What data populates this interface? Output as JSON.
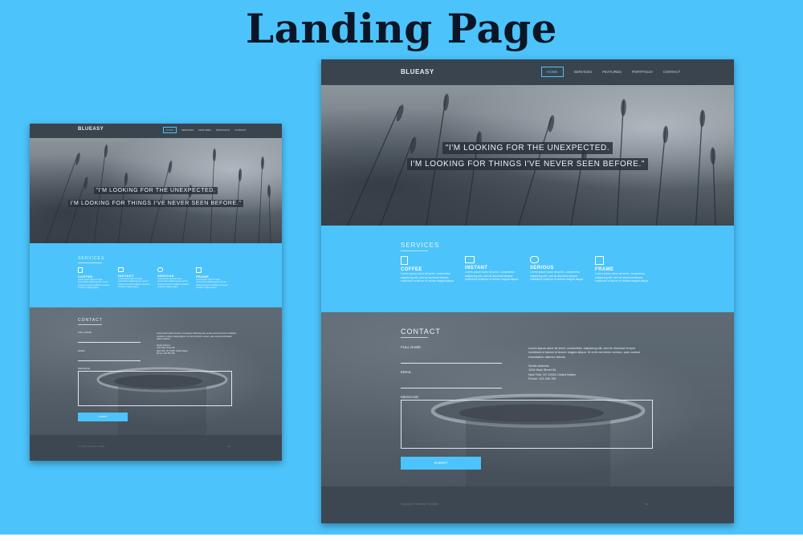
{
  "title": "Landing Page",
  "brand": "BLUEASY",
  "nav": [
    "HOME",
    "SERVICES",
    "FEATURES",
    "PORTFOLIO",
    "CONTACT"
  ],
  "quote": {
    "line1": "\"I'M LOOKING FOR THE UNEXPECTED.",
    "line2": "I'M LOOKING FOR THINGS I'VE NEVER SEEN BEFORE.\""
  },
  "services": {
    "title": "SERVICES",
    "items": [
      {
        "name": "COFFEE",
        "icon": "coffee-cup-icon",
        "desc": "Lorem ipsum dolor sit amet, consectetur adipiscing elit, sed do eiusmod tempor incididunt ut labore et dolore magna aliqua."
      },
      {
        "name": "INSTANT",
        "icon": "monitor-icon",
        "desc": "Lorem ipsum dolor sit amet, consectetur adipiscing elit, sed do eiusmod tempor incididunt ut labore et dolore magna aliqua."
      },
      {
        "name": "SERIOUS",
        "icon": "people-icon",
        "desc": "Lorem ipsum dolor sit amet, consectetur adipiscing elit, sed do eiusmod tempor incididunt ut labore et dolore magna aliqua."
      },
      {
        "name": "FRAME",
        "icon": "frame-icon",
        "desc": "Lorem ipsum dolor sit amet, consectetur adipiscing elit, sed do eiusmod tempor incididunt ut labore et dolore magna aliqua."
      }
    ]
  },
  "contact": {
    "title": "CONTACT",
    "full_name": "FULL NAME",
    "email": "EMAIL",
    "message": "MESSAGE",
    "submit": "SUBMIT",
    "blurb": "Lorem ipsum dolor sit amet, consectetur adipiscing elit, sed do eiusmod tempor incididunt ut labore et dolore magna aliqua. Ut enim ad minim veniam, quis nostrud exercitation ullamco laboris.",
    "address": [
      "Studio Address",
      "1234 Main Street 56",
      "New York, NY 10001 United States",
      "Phone: 123 456 789"
    ]
  },
  "footer": {
    "left": "Copyright © Blueasy Template",
    "right": "Top"
  },
  "colors": {
    "accent": "#4cc3fb",
    "dark": "#3d4752",
    "title": "#0a1626"
  }
}
